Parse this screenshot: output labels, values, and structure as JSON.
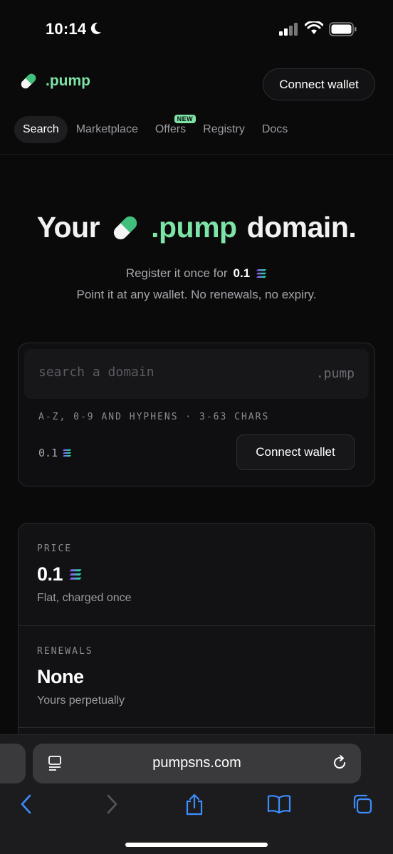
{
  "status_bar": {
    "time": "10:14"
  },
  "header": {
    "logo_text": ".pump",
    "connect_label": "Connect wallet"
  },
  "nav": {
    "items": [
      {
        "label": "Search",
        "active": true
      },
      {
        "label": "Marketplace"
      },
      {
        "label": "Offers",
        "badge": "NEW"
      },
      {
        "label": "Registry"
      },
      {
        "label": "Docs"
      }
    ]
  },
  "hero": {
    "title_prefix": "Your",
    "title_highlight": ".pump",
    "title_suffix": "domain.",
    "sub_prefix": "Register it once for",
    "sub_price": "0.1",
    "sub_line2": "Point it at any wallet. No renewals, no expiry."
  },
  "search_card": {
    "placeholder": "search a domain",
    "suffix": ".pump",
    "hint": "A-Z, 0-9 AND HYPHENS · 3-63 CHARS",
    "price": "0.1",
    "connect_label": "Connect wallet"
  },
  "info": {
    "price": {
      "label": "PRICE",
      "value": "0.1",
      "note": "Flat, charged once"
    },
    "renewals": {
      "label": "RENEWALS",
      "value": "None",
      "note": "Yours perpetually"
    }
  },
  "browser": {
    "url": "pumpsns.com"
  },
  "colors": {
    "accent": "#7ee3a6",
    "background": "#0a0a0b",
    "ios_blue": "#3c8dff"
  }
}
